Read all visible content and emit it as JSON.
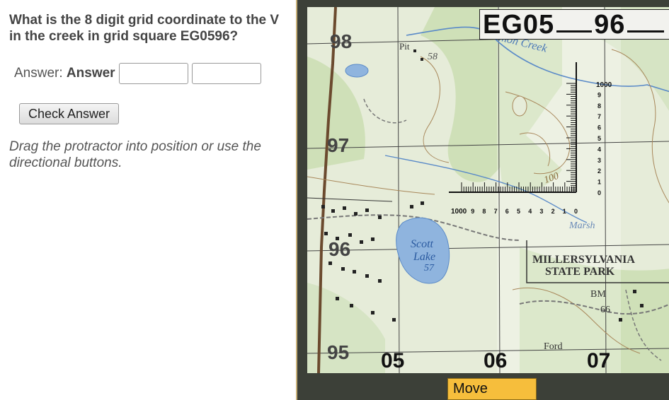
{
  "question": {
    "text": "What is the 8 digit grid coordinate to the V in the creek in grid square EG0596?"
  },
  "answer": {
    "label_prefix": "Answer: ",
    "label_bold": "Answer",
    "input1_value": "",
    "input2_value": ""
  },
  "check_button": {
    "label": "Check Answer"
  },
  "hint": {
    "text": "Drag the protractor into position or use the directional buttons."
  },
  "map": {
    "grid_title_prefix": "EG05",
    "grid_title_suffix": "96",
    "northings": [
      "98",
      "97",
      "96",
      "95"
    ],
    "eastings": [
      "05",
      "06",
      "07"
    ],
    "features": {
      "creek_label": "Salmon Creek",
      "lake_label_1": "Scott",
      "lake_label_2": "Lake",
      "lake_elevation": "57",
      "park_label_1": "MILLERSYLVANIA",
      "park_label_2": "STATE PARK",
      "benchmark_label": "BM",
      "benchmark_value": "66",
      "ford_label": "Ford",
      "pit_label": "Pit",
      "spot_elevation": "58",
      "contour_label": "100",
      "marsh_label": "Marsh"
    },
    "protractor": {
      "vertical_scale_top": "1000",
      "vertical_ticks": [
        "9",
        "8",
        "7",
        "6",
        "5",
        "4",
        "3",
        "2",
        "1",
        "0"
      ],
      "horizontal_scale_left": "1000",
      "horizontal_ticks": [
        "9",
        "8",
        "7",
        "6",
        "5",
        "4",
        "3",
        "2",
        "1",
        "0"
      ]
    }
  },
  "move_button": {
    "label": "Move"
  },
  "colors": {
    "map_bg": "#e6ecd9",
    "vegetation": "#cfe0b8",
    "water": "#8fb4de",
    "contour": "#a8875a",
    "panel_bg": "#3c4038",
    "move_button": "#f6be3c"
  }
}
